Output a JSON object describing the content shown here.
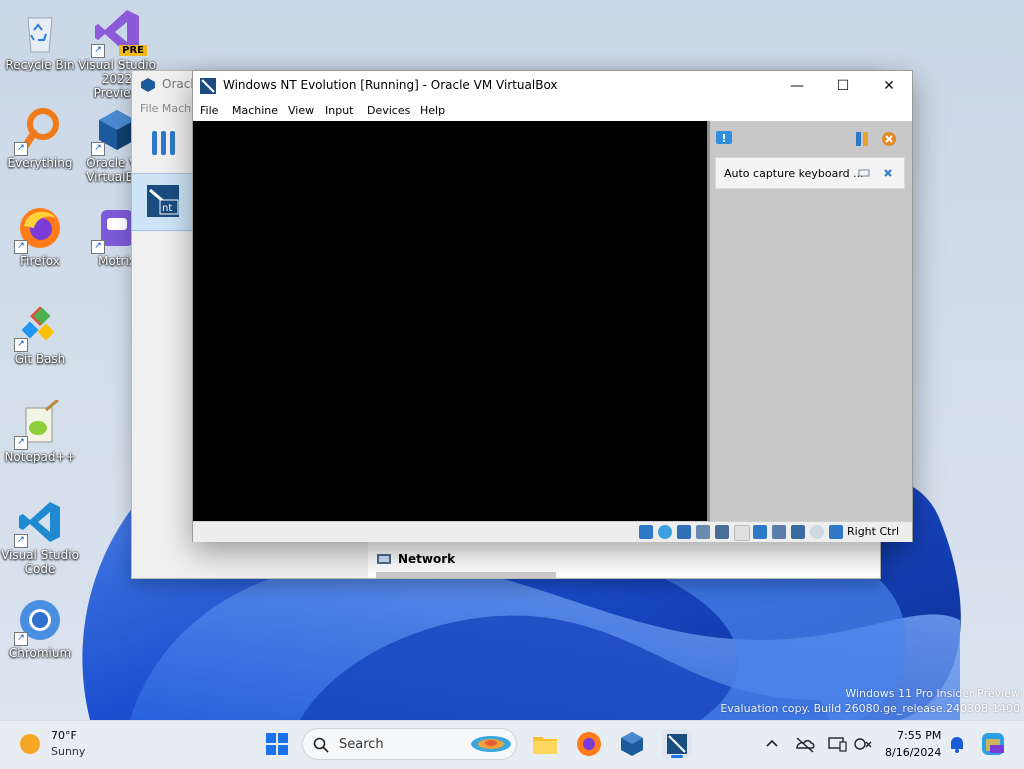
{
  "desktop": {
    "icons": [
      {
        "label": "Recycle Bin"
      },
      {
        "label": "Everything"
      },
      {
        "label": "Firefox"
      },
      {
        "label": "Git Bash"
      },
      {
        "label": "Notepad++"
      },
      {
        "label": "Visual Studio Code"
      },
      {
        "label": "Chromium"
      },
      {
        "label": "Visual Studio 2022 Preview"
      },
      {
        "label": "Oracle VM VirtualBox"
      },
      {
        "label": "Motrix"
      }
    ],
    "vs_badge": "PRE"
  },
  "manager_window": {
    "title": "Oracle VM VirtualBox Manager",
    "menu": "File  Machine",
    "network_label": "Network"
  },
  "vm_window": {
    "title": "Windows NT Evolution [Running] - Oracle VM VirtualBox",
    "menu": [
      "File",
      "Machine",
      "View",
      "Input",
      "Devices",
      "Help"
    ],
    "notice_text": "Auto capture keyboard ...",
    "host_key": "Right Ctrl",
    "controls": {
      "minimize": "—",
      "maximize": "☐",
      "close": "✕"
    }
  },
  "watermark": {
    "line1": "Windows 11 Pro Insider Preview",
    "line2": "Evaluation copy. Build 26080.ge_release.240308-1400"
  },
  "taskbar": {
    "weather_temp": "70°F",
    "weather_condition": "Sunny",
    "search_placeholder": "Search",
    "time": "7:55 PM",
    "date": "8/16/2024",
    "apps": [
      "start-icon",
      "file-explorer-icon",
      "firefox-icon",
      "virtualbox-icon",
      "virtualbox-vm-icon"
    ],
    "tray": [
      "chevron-up-icon",
      "onedrive-icon",
      "display-icon",
      "accessibility-icon",
      "notification-bell-icon",
      "copilot-icon"
    ]
  },
  "colors": {
    "accent": "#1a73e8",
    "wallpaper_blue": "#1e5bd6"
  }
}
